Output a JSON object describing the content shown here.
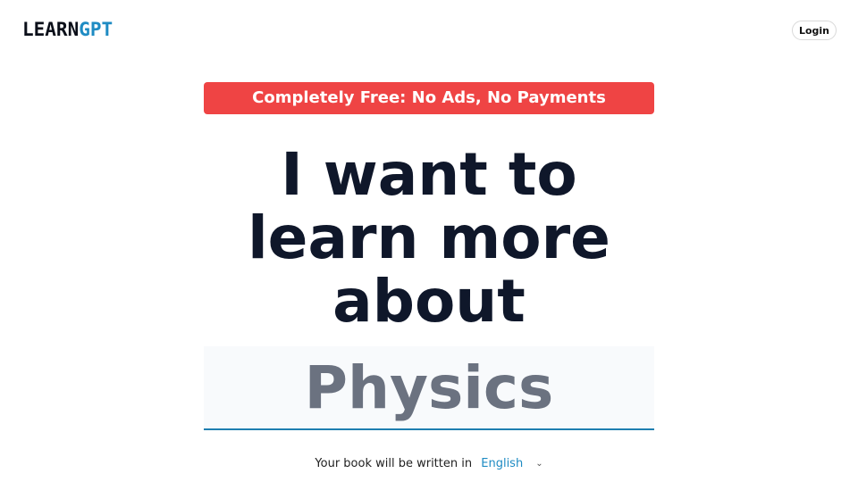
{
  "header": {
    "logo_part1": "LEARN",
    "logo_part2": "GPT",
    "login_label": "Login"
  },
  "banner": {
    "text": "Completely Free: No Ads, No Payments"
  },
  "hero": {
    "line1": "I want to",
    "line2": "learn more",
    "line3": "about"
  },
  "topic": {
    "placeholder": "Physics"
  },
  "language": {
    "label": "Your book will be written in",
    "selected": "English",
    "icon": "chevron-down-icon"
  },
  "colors": {
    "brand_dark": "#0b0f19",
    "brand_accent": "#1e8bc3",
    "banner": "#ef4444",
    "headline": "#0f172a",
    "placeholder": "#6b7280"
  }
}
